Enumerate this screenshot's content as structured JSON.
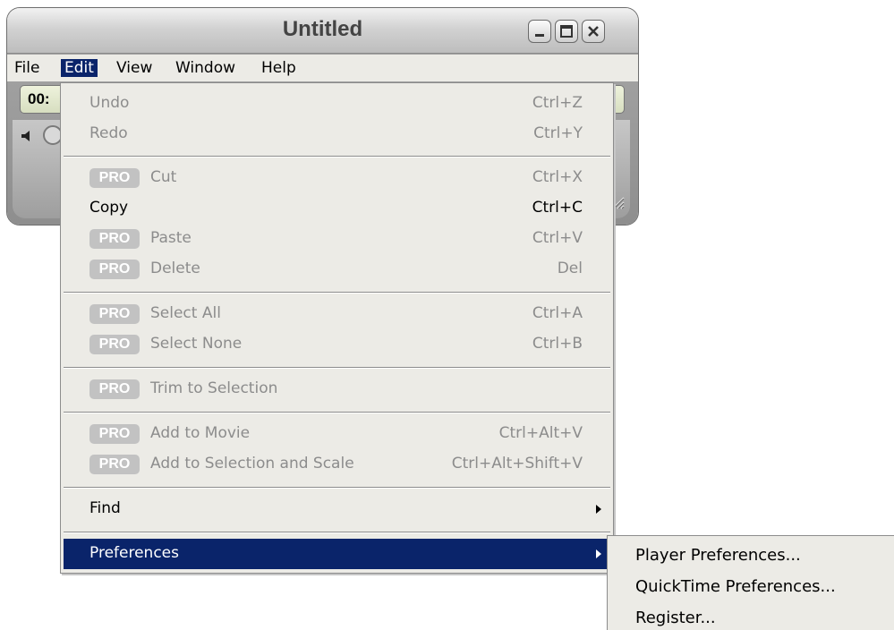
{
  "window": {
    "title": "Untitled",
    "time_display": "00:"
  },
  "menubar": {
    "items": [
      "File",
      "Edit",
      "View",
      "Window",
      "Help"
    ],
    "active": "Edit"
  },
  "edit_menu": {
    "pro_badge": "PRO",
    "undo": {
      "label": "Undo",
      "shortcut": "Ctrl+Z",
      "enabled": false
    },
    "redo": {
      "label": "Redo",
      "shortcut": "Ctrl+Y",
      "enabled": false
    },
    "cut": {
      "label": "Cut",
      "shortcut": "Ctrl+X",
      "enabled": false,
      "pro": true
    },
    "copy": {
      "label": "Copy",
      "shortcut": "Ctrl+C",
      "enabled": true
    },
    "paste": {
      "label": "Paste",
      "shortcut": "Ctrl+V",
      "enabled": false,
      "pro": true
    },
    "delete": {
      "label": "Delete",
      "shortcut": "Del",
      "enabled": false,
      "pro": true
    },
    "select_all": {
      "label": "Select All",
      "shortcut": "Ctrl+A",
      "enabled": false,
      "pro": true
    },
    "select_none": {
      "label": "Select None",
      "shortcut": "Ctrl+B",
      "enabled": false,
      "pro": true
    },
    "trim": {
      "label": "Trim to Selection",
      "enabled": false,
      "pro": true
    },
    "add_to_movie": {
      "label": "Add to Movie",
      "shortcut": "Ctrl+Alt+V",
      "enabled": false,
      "pro": true
    },
    "add_scale": {
      "label": "Add to Selection and Scale",
      "shortcut": "Ctrl+Alt+Shift+V",
      "enabled": false,
      "pro": true
    },
    "find": {
      "label": "Find",
      "has_submenu": true
    },
    "preferences": {
      "label": "Preferences",
      "has_submenu": true,
      "selected": true
    }
  },
  "preferences_submenu": {
    "items": [
      "Player Preferences...",
      "QuickTime Preferences...",
      "Register..."
    ]
  },
  "colors": {
    "highlight": "#0a246a",
    "menu_bg": "#ecebe6",
    "disabled_text": "#8c8c8c",
    "pro_badge_bg": "#c2c2c2"
  }
}
